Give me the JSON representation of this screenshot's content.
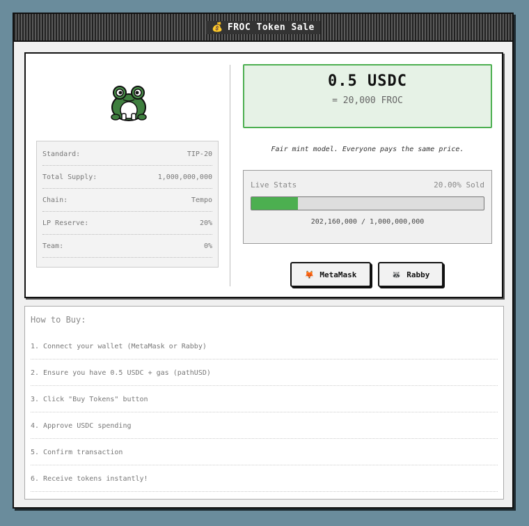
{
  "window": {
    "title": "FROC Token Sale",
    "title_icon": "money-bag-icon"
  },
  "token": {
    "logo": "frog-icon",
    "specs": [
      {
        "label": "Standard:",
        "value": "TIP-20"
      },
      {
        "label": "Total Supply:",
        "value": "1,000,000,000"
      },
      {
        "label": "Chain:",
        "value": "Tempo"
      },
      {
        "label": "LP Reserve:",
        "value": "20%"
      },
      {
        "label": "Team:",
        "value": "0%"
      }
    ]
  },
  "price": {
    "main": "0.5 USDC",
    "sub": "= 20,000 FROC",
    "note": "Fair mint model. Everyone pays the same price."
  },
  "stats": {
    "title": "Live Stats",
    "sold_label": "20.00% Sold",
    "progress_fraction": 0.2,
    "count_text": "202,160,000 / 1,000,000,000"
  },
  "wallets": [
    {
      "label": "MetaMask",
      "icon": "fox-icon"
    },
    {
      "label": "Rabby",
      "icon": "rabbit-icon"
    }
  ],
  "howto": {
    "title": "How to Buy:",
    "steps": [
      "1. Connect your wallet (MetaMask or Rabby)",
      "2. Ensure you have 0.5 USDC + gas (pathUSD)",
      "3. Click \"Buy Tokens\" button",
      "4. Approve USDC spending",
      "5. Confirm transaction",
      "6. Receive tokens instantly!"
    ]
  },
  "colors": {
    "accent_green": "#4caf50",
    "price_bg": "#e6f2e6",
    "desktop_bg": "#6a8c9c"
  }
}
